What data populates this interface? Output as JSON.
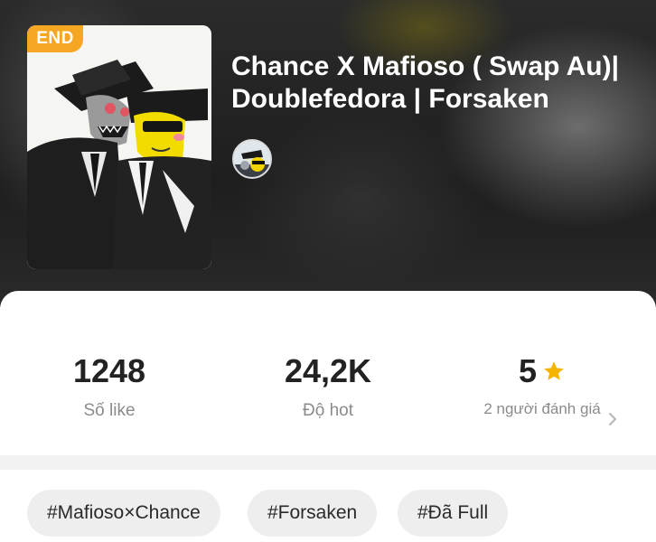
{
  "story": {
    "status_badge": "END",
    "title": "Chance X Mafioso ( Swap Au)| Doublefedora | Forsaken"
  },
  "stats": {
    "likes_value": "1248",
    "likes_label": "Số like",
    "hot_value": "24,2K",
    "hot_label": "Độ hot",
    "rating_value": "5",
    "rating_label": "2 người đánh giá"
  },
  "tags": [
    "#Mafioso×Chance",
    "#Forsaken",
    "#Đã Full"
  ],
  "icons": {
    "rating": "star-icon",
    "more": "chevron-right-icon"
  },
  "colors": {
    "badge": "#f5a623",
    "star": "#f5b400",
    "tag_bg": "#eeeeee"
  }
}
